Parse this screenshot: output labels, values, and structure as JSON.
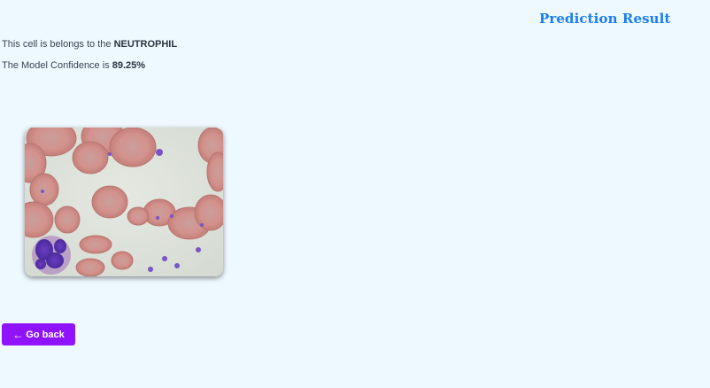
{
  "header": {
    "title": "Prediction Result"
  },
  "result": {
    "line1_prefix": "This cell is belongs to the ",
    "cell_type": "NEUTROPHIL",
    "line2_prefix": "The Model Confidence is ",
    "confidence": "89.25%"
  },
  "image": {
    "subject": "blood-smear-microscope-image"
  },
  "actions": {
    "back_icon": "←",
    "back_label": "Go back"
  },
  "colors": {
    "title": "#1a7ff0",
    "button": "#9013fe",
    "background": "#eef8ff"
  }
}
